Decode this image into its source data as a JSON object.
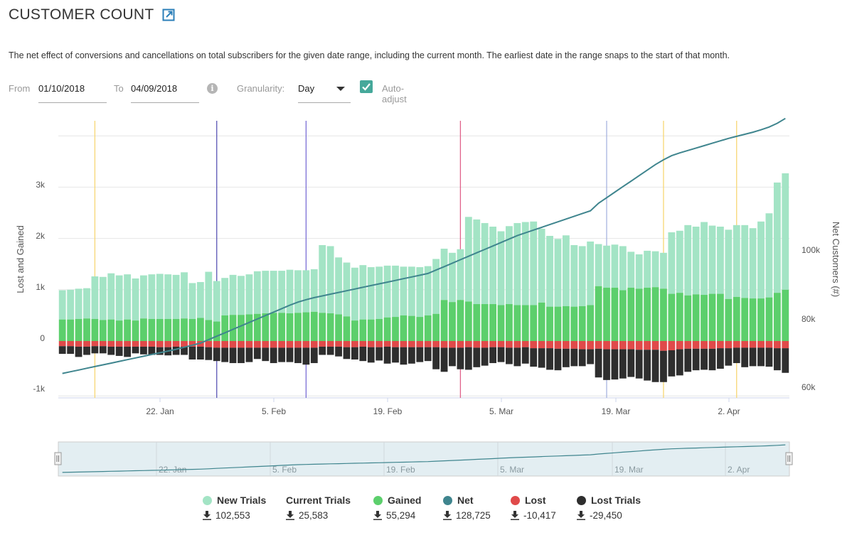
{
  "header": {
    "title": "CUSTOMER COUNT",
    "external_link_icon": "external-link-icon",
    "description": "The net effect of conversions and cancellations on total subscribers for the given date range, including the current month. The earliest date in the range snaps to the start of that month."
  },
  "controls": {
    "from_label": "From",
    "from_value": "01/10/2018",
    "to_label": "To",
    "to_value": "04/09/2018",
    "info_icon": "info-icon",
    "granularity_label": "Granularity:",
    "granularity_value": "Day",
    "auto_adjust_label": "Auto-adjust",
    "auto_adjust_checked": true
  },
  "legend": [
    {
      "name": "New Trials",
      "value": "102,553",
      "color": "#a3e4c5"
    },
    {
      "name": "Current Trials",
      "value": "25,583",
      "color": null
    },
    {
      "name": "Gained",
      "value": "55,294",
      "color": "#5ccf6c"
    },
    {
      "name": "Net",
      "value": "128,725",
      "color": "#3f858e"
    },
    {
      "name": "Lost",
      "value": "-10,417",
      "color": "#e04a4a"
    },
    {
      "name": "Lost Trials",
      "value": "-29,450",
      "color": "#2e2e2e"
    }
  ],
  "chart_data": {
    "type": "bar",
    "title": "Customer Count",
    "xlabel": "",
    "ylabel": "Lost and Gained",
    "y2label": "Net Customers (#)",
    "ylim": [
      -1100,
      4000
    ],
    "y2lim": [
      58000,
      142000
    ],
    "yticks": [
      "-1k",
      "0",
      "1k",
      "2k",
      "3k"
    ],
    "y2ticks": [
      "60k",
      "80k",
      "100k"
    ],
    "xticks": [
      "22. Jan",
      "5. Feb",
      "19. Feb",
      "5. Mar",
      "19. Mar",
      "2. Apr"
    ],
    "x_start": "2018-01-10",
    "x_end": "2018-04-09",
    "grid": true,
    "legend_position": "bottom",
    "navigator_ticks": [
      "22. Jan",
      "5. Feb",
      "19. Feb",
      "5. Mar",
      "19. Mar",
      "2. Apr"
    ],
    "plot_bands": [
      {
        "date_index": 4.5,
        "color": "#f7d774"
      },
      {
        "date_index": 19.5,
        "color": "#5a55b5"
      },
      {
        "date_index": 30.5,
        "color": "#7b6fd6"
      },
      {
        "date_index": 49.5,
        "color": "#e0628a"
      },
      {
        "date_index": 67.5,
        "color": "#a7b3e0"
      },
      {
        "date_index": 74.5,
        "color": "#f7d774"
      },
      {
        "date_index": 83.5,
        "color": "#f7d774"
      }
    ],
    "series": [
      {
        "name": "Gained",
        "stack": "pos",
        "color": "#5ccf6c",
        "values": [
          420,
          420,
          430,
          440,
          430,
          410,
          420,
          400,
          420,
          400,
          440,
          430,
          430,
          430,
          430,
          440,
          430,
          450,
          410,
          380,
          500,
          510,
          510,
          520,
          530,
          540,
          550,
          550,
          540,
          550,
          560,
          570,
          550,
          540,
          520,
          480,
          400,
          420,
          420,
          430,
          460,
          470,
          500,
          490,
          470,
          500,
          530,
          800,
          760,
          800,
          770,
          720,
          720,
          720,
          700,
          720,
          700,
          700,
          700,
          750,
          670,
          670,
          680,
          670,
          680,
          700,
          1070,
          1040,
          1040,
          990,
          1040,
          1020,
          1040,
          1050,
          1020,
          920,
          940,
          890,
          910,
          900,
          920,
          920,
          820,
          860,
          840,
          830,
          830,
          850,
          940,
          1000
        ]
      },
      {
        "name": "New Trials",
        "stack": "pos",
        "color": "#a3e4c5",
        "values": [
          570,
          580,
          590,
          590,
          830,
          840,
          900,
          880,
          880,
          820,
          840,
          870,
          880,
          870,
          860,
          900,
          700,
          700,
          940,
          790,
          730,
          780,
          760,
          780,
          830,
          830,
          820,
          820,
          850,
          830,
          820,
          830,
          1320,
          1310,
          1110,
          1050,
          1030,
          1060,
          1020,
          1020,
          1010,
          1000,
          950,
          960,
          970,
          960,
          1070,
          1000,
          960,
          990,
          1650,
          1650,
          1580,
          1510,
          1440,
          1520,
          1600,
          1620,
          1630,
          1440,
          1380,
          1320,
          1380,
          1200,
          1170,
          1240,
          820,
          820,
          840,
          860,
          700,
          670,
          720,
          700,
          700,
          1200,
          1210,
          1370,
          1320,
          1420,
          1330,
          1310,
          1350,
          1400,
          1420,
          1370,
          1500,
          1640,
          2150,
          2270
        ]
      },
      {
        "name": "Lost",
        "stack": "neg",
        "color": "#e04a4a",
        "values": [
          -100,
          -100,
          -110,
          -110,
          -100,
          -100,
          -110,
          -110,
          -110,
          -110,
          -110,
          -110,
          -120,
          -120,
          -110,
          -110,
          -110,
          -110,
          -120,
          -130,
          -130,
          -130,
          -130,
          -130,
          -130,
          -130,
          -130,
          -130,
          -130,
          -130,
          -130,
          -130,
          -110,
          -110,
          -110,
          -120,
          -120,
          -110,
          -120,
          -120,
          -110,
          -120,
          -120,
          -120,
          -120,
          -120,
          -120,
          -130,
          -130,
          -130,
          -120,
          -130,
          -130,
          -120,
          -120,
          -130,
          -130,
          -120,
          -140,
          -140,
          -140,
          -150,
          -150,
          -150,
          -160,
          -160,
          -150,
          -160,
          -160,
          -160,
          -160,
          -170,
          -170,
          -170,
          -190,
          -180,
          -160,
          -150,
          -150,
          -150,
          -150,
          -140,
          -140,
          -130,
          -130,
          -130,
          -130,
          -130,
          -140,
          -140
        ]
      },
      {
        "name": "Lost Trials",
        "stack": "neg",
        "color": "#2e2e2e",
        "values": [
          -150,
          -150,
          -200,
          -160,
          -140,
          -140,
          -160,
          -180,
          -200,
          -130,
          -150,
          -160,
          -150,
          -160,
          -160,
          -160,
          -250,
          -250,
          -250,
          -260,
          -280,
          -300,
          -300,
          -280,
          -220,
          -260,
          -300,
          -280,
          -280,
          -300,
          -330,
          -300,
          -160,
          -160,
          -190,
          -230,
          -240,
          -280,
          -300,
          -260,
          -330,
          -300,
          -340,
          -320,
          -290,
          -270,
          -430,
          -470,
          -360,
          -420,
          -440,
          -380,
          -350,
          -310,
          -290,
          -320,
          -360,
          -320,
          -360,
          -380,
          -420,
          -420,
          -360,
          -340,
          -330,
          -290,
          -560,
          -600,
          -590,
          -570,
          -540,
          -560,
          -600,
          -630,
          -610,
          -510,
          -510,
          -450,
          -420,
          -410,
          -420,
          -400,
          -340,
          -300,
          -380,
          -360,
          -360,
          -370,
          -430,
          -480
        ]
      },
      {
        "name": "Net",
        "type": "line",
        "axis": "right",
        "color": "#3f858e",
        "values": [
          64000,
          64500,
          65000,
          65500,
          66000,
          66500,
          67000,
          67500,
          68000,
          68500,
          69000,
          69500,
          70000,
          70500,
          71000,
          71600,
          72200,
          72800,
          73800,
          74800,
          75800,
          76800,
          77800,
          78800,
          79800,
          80800,
          81800,
          82800,
          83800,
          84700,
          85400,
          86000,
          86500,
          87000,
          87500,
          88000,
          88500,
          89000,
          89500,
          90000,
          90500,
          91000,
          91500,
          92000,
          92500,
          93000,
          94000,
          95000,
          96000,
          97000,
          98000,
          99000,
          100000,
          101000,
          102000,
          103000,
          104000,
          104800,
          105600,
          106400,
          107200,
          108000,
          108800,
          109600,
          110400,
          111200,
          113400,
          115000,
          116600,
          118200,
          119800,
          121400,
          123000,
          124600,
          126000,
          127200,
          128000,
          128700,
          129400,
          130100,
          130800,
          131500,
          132200,
          132800,
          133400,
          134000,
          134700,
          135500,
          136600,
          138000
        ]
      }
    ]
  }
}
